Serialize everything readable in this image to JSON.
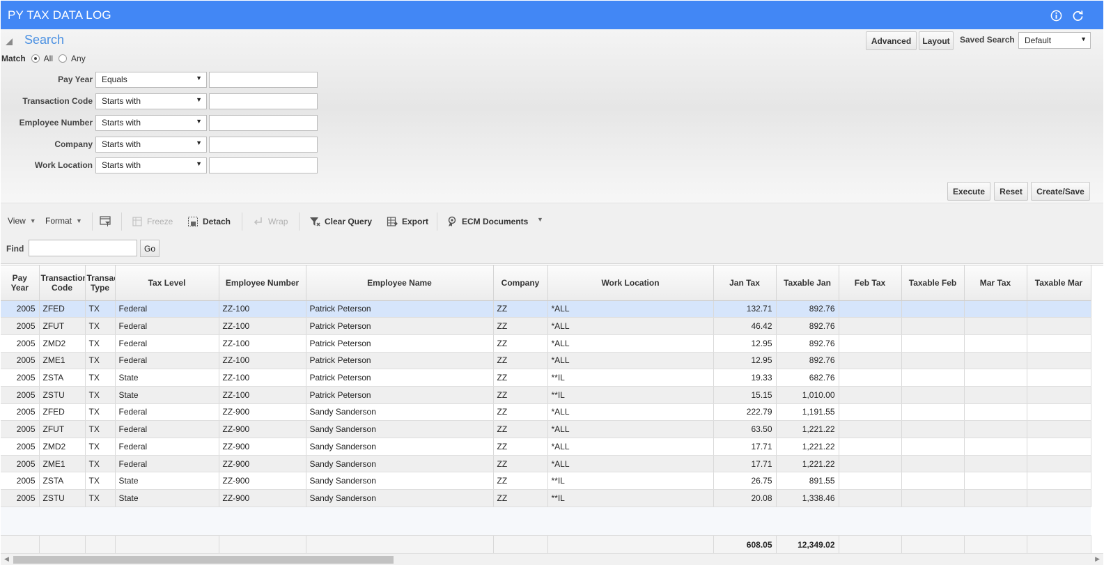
{
  "window": {
    "title": "PY TAX DATA LOG"
  },
  "search": {
    "title": "Search",
    "match_label": "Match",
    "match_all": "All",
    "match_any": "Any",
    "criteria": [
      {
        "label": "Pay Year",
        "operator": "Equals",
        "value": ""
      },
      {
        "label": "Transaction Code",
        "operator": "Starts with",
        "value": ""
      },
      {
        "label": "Employee Number",
        "operator": "Starts with",
        "value": ""
      },
      {
        "label": "Company",
        "operator": "Starts with",
        "value": ""
      },
      {
        "label": "Work Location",
        "operator": "Starts with",
        "value": ""
      }
    ],
    "advanced_label": "Advanced",
    "layout_label": "Layout",
    "saved_search_label": "Saved Search",
    "saved_search_value": "Default",
    "execute_label": "Execute",
    "reset_label": "Reset",
    "create_save_label": "Create/Save"
  },
  "toolbar": {
    "view": "View",
    "format": "Format",
    "freeze": "Freeze",
    "detach": "Detach",
    "wrap": "Wrap",
    "clear_query": "Clear Query",
    "export": "Export",
    "ecm_documents": "ECM Documents",
    "find_label": "Find",
    "find_value": "",
    "go": "Go"
  },
  "grid": {
    "headers": [
      "Pay\nYear",
      "Transaction\nCode",
      "Transaction\nType",
      "Tax Level",
      "Employee Number",
      "Employee Name",
      "Company",
      "Work Location",
      "Jan Tax",
      "Taxable Jan",
      "Feb Tax",
      "Taxable Feb",
      "Mar Tax",
      "Taxable Mar"
    ],
    "rows": [
      [
        "2005",
        "ZFED",
        "TX",
        "Federal",
        "ZZ-100",
        "Patrick Peterson",
        "ZZ",
        "*ALL",
        "132.71",
        "892.76",
        "",
        "",
        "",
        ""
      ],
      [
        "2005",
        "ZFUT",
        "TX",
        "Federal",
        "ZZ-100",
        "Patrick Peterson",
        "ZZ",
        "*ALL",
        "46.42",
        "892.76",
        "",
        "",
        "",
        ""
      ],
      [
        "2005",
        "ZMD2",
        "TX",
        "Federal",
        "ZZ-100",
        "Patrick Peterson",
        "ZZ",
        "*ALL",
        "12.95",
        "892.76",
        "",
        "",
        "",
        ""
      ],
      [
        "2005",
        "ZME1",
        "TX",
        "Federal",
        "ZZ-100",
        "Patrick Peterson",
        "ZZ",
        "*ALL",
        "12.95",
        "892.76",
        "",
        "",
        "",
        ""
      ],
      [
        "2005",
        "ZSTA",
        "TX",
        "State",
        "ZZ-100",
        "Patrick Peterson",
        "ZZ",
        "**IL",
        "19.33",
        "682.76",
        "",
        "",
        "",
        ""
      ],
      [
        "2005",
        "ZSTU",
        "TX",
        "State",
        "ZZ-100",
        "Patrick Peterson",
        "ZZ",
        "**IL",
        "15.15",
        "1,010.00",
        "",
        "",
        "",
        ""
      ],
      [
        "2005",
        "ZFED",
        "TX",
        "Federal",
        "ZZ-900",
        "Sandy Sanderson",
        "ZZ",
        "*ALL",
        "222.79",
        "1,191.55",
        "",
        "",
        "",
        ""
      ],
      [
        "2005",
        "ZFUT",
        "TX",
        "Federal",
        "ZZ-900",
        "Sandy Sanderson",
        "ZZ",
        "*ALL",
        "63.50",
        "1,221.22",
        "",
        "",
        "",
        ""
      ],
      [
        "2005",
        "ZMD2",
        "TX",
        "Federal",
        "ZZ-900",
        "Sandy Sanderson",
        "ZZ",
        "*ALL",
        "17.71",
        "1,221.22",
        "",
        "",
        "",
        ""
      ],
      [
        "2005",
        "ZME1",
        "TX",
        "Federal",
        "ZZ-900",
        "Sandy Sanderson",
        "ZZ",
        "*ALL",
        "17.71",
        "1,221.22",
        "",
        "",
        "",
        ""
      ],
      [
        "2005",
        "ZSTA",
        "TX",
        "State",
        "ZZ-900",
        "Sandy Sanderson",
        "ZZ",
        "**IL",
        "26.75",
        "891.55",
        "",
        "",
        "",
        ""
      ],
      [
        "2005",
        "ZSTU",
        "TX",
        "State",
        "ZZ-900",
        "Sandy Sanderson",
        "ZZ",
        "**IL",
        "20.08",
        "1,338.46",
        "",
        "",
        "",
        ""
      ]
    ],
    "totals": [
      "",
      "",
      "",
      "",
      "",
      "",
      "",
      "",
      "608.05",
      "12,349.02",
      "",
      "",
      "",
      ""
    ],
    "selected_row": 0
  },
  "colors": {
    "title_bar": "#4287f5",
    "search_title": "#4a90e2",
    "selected_row": "#d6e5fb"
  },
  "icons": [
    "info-icon",
    "refresh-icon",
    "collapse-triangle-icon",
    "filter-settings-icon",
    "freeze-icon",
    "detach-icon",
    "wrap-icon",
    "clear-query-icon",
    "export-icon",
    "ecm-documents-icon"
  ]
}
